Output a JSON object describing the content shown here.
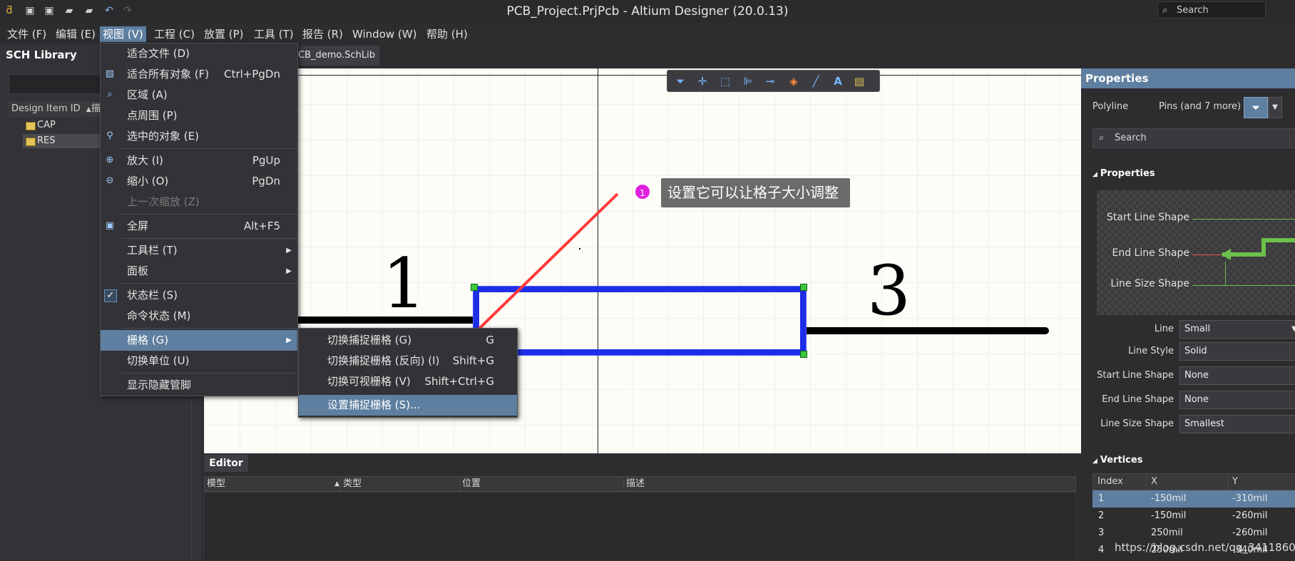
{
  "window": {
    "title": "PCB_Project.PrjPcb - Altium Designer (20.0.13)",
    "search_placeholder": "Search"
  },
  "menubar": [
    {
      "label": "文件 (F)"
    },
    {
      "label": "编辑 (E)"
    },
    {
      "label": "视图 (V)",
      "active": true
    },
    {
      "label": "工程 (C)"
    },
    {
      "label": "放置 (P)"
    },
    {
      "label": "工具 (T)"
    },
    {
      "label": "报告 (R)"
    },
    {
      "label": "Window (W)"
    },
    {
      "label": "帮助 (H)"
    }
  ],
  "left_panel": {
    "title": "SCH Library",
    "column_header": "Design Item ID",
    "column_header_2": "描",
    "items": [
      "CAP",
      "RES"
    ],
    "selected": "RES"
  },
  "document_tab": "CB_demo.SchLib *",
  "canvas": {
    "pin_left_label": "1",
    "pin_right_label": "3"
  },
  "annotation": {
    "badge": "1",
    "text": "设置它可以让格子大小调整"
  },
  "view_menu": {
    "items": [
      {
        "label": "适合文件 (D)",
        "shortcut": "",
        "icon": ""
      },
      {
        "label": "适合所有对象 (F)",
        "shortcut": "Ctrl+PgDn",
        "icon": "fit-all-icon"
      },
      {
        "label": "区域 (A)",
        "shortcut": "",
        "icon": "area-zoom-icon"
      },
      {
        "label": "点周围 (P)",
        "shortcut": "",
        "icon": ""
      },
      {
        "label": "选中的对象 (E)",
        "shortcut": "",
        "icon": "selected-objects-icon"
      },
      {
        "label": "放大 (I)",
        "shortcut": "PgUp",
        "icon": "zoom-in-icon"
      },
      {
        "label": "缩小 (O)",
        "shortcut": "PgDn",
        "icon": "zoom-out-icon"
      },
      {
        "label": "上一次缩放 (Z)",
        "shortcut": "",
        "icon": "",
        "disabled": true
      },
      {
        "label": "全屏",
        "shortcut": "Alt+F5",
        "icon": "fullscreen-icon"
      },
      {
        "label": "工具栏 (T)",
        "shortcut": "",
        "submenu": true
      },
      {
        "label": "面板",
        "shortcut": "",
        "submenu": true
      },
      {
        "label": "状态栏 (S)",
        "shortcut": "",
        "icon": "check-icon"
      },
      {
        "label": "命令状态 (M)",
        "shortcut": ""
      },
      {
        "label": "栅格 (G)",
        "shortcut": "",
        "submenu": true,
        "highlighted": true
      },
      {
        "label": "切换单位 (U)",
        "shortcut": ""
      },
      {
        "label": "显示隐藏管脚",
        "shortcut": ""
      }
    ]
  },
  "grid_menu": {
    "items": [
      {
        "label": "切换捕捉栅格 (G)",
        "shortcut": "G"
      },
      {
        "label": "切换捕捉栅格 (反向) (I)",
        "shortcut": "Shift+G"
      },
      {
        "label": "切换可视栅格 (V)",
        "shortcut": "Shift+Ctrl+G"
      },
      {
        "label": "设置捕捉栅格 (S)...",
        "shortcut": "",
        "highlighted": true
      }
    ]
  },
  "editor": {
    "tab": "Editor",
    "columns": [
      "模型",
      "类型",
      "位置",
      "描述"
    ]
  },
  "properties": {
    "title": "Properties",
    "object_kind": "Polyline",
    "filter_text": "Pins (and 7 more)",
    "search_placeholder": "Search",
    "section_properties": "Properties",
    "preview_labels": {
      "start": "Start Line Shape",
      "end": "End Line Shape",
      "size": "Line Size Shape"
    },
    "fields": [
      {
        "label": "Line",
        "value": "Small"
      },
      {
        "label": "Line Style",
        "value": "Solid"
      },
      {
        "label": "Start Line Shape",
        "value": "None"
      },
      {
        "label": "End Line Shape",
        "value": "None"
      },
      {
        "label": "Line Size Shape",
        "value": "Smallest"
      }
    ],
    "section_vertices": "Vertices",
    "vertices_headers": [
      "Index",
      "X",
      "Y"
    ],
    "vertices": [
      {
        "index": "1",
        "x": "-150mil",
        "y": "-310mil"
      },
      {
        "index": "2",
        "x": "-150mil",
        "y": "-260mil"
      },
      {
        "index": "3",
        "x": "250mil",
        "y": "-260mil"
      },
      {
        "index": "4",
        "x": "250mil",
        "y": "-340mil"
      }
    ]
  },
  "watermark": "https://blog.csdn.net/qq_34118600"
}
